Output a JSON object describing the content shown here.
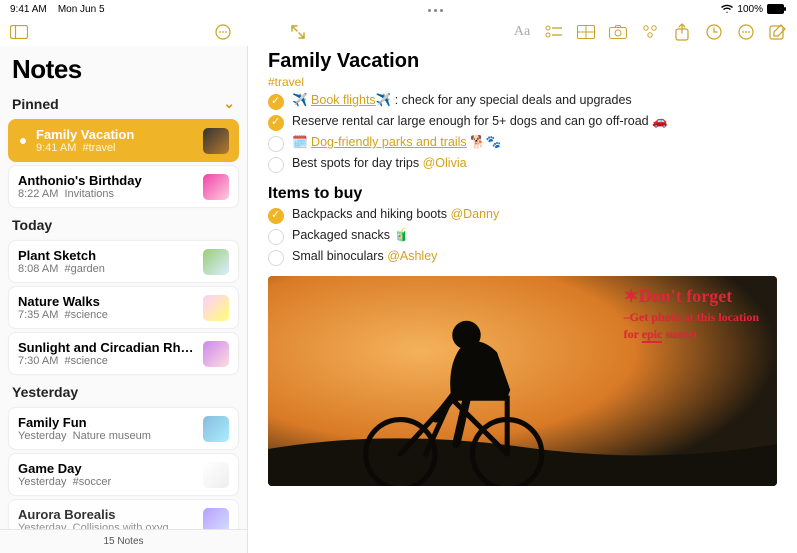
{
  "statusbar": {
    "time": "9:41 AM",
    "date": "Mon Jun 5",
    "battery": "100%"
  },
  "sidebar": {
    "title": "Notes",
    "sections": {
      "pinned": {
        "label": "Pinned",
        "items": [
          {
            "title": "Family Vacation",
            "time": "9:41 AM",
            "tag": "#travel"
          },
          {
            "title": "Anthonio's Birthday",
            "time": "8:22 AM",
            "tag": "Invitations"
          }
        ]
      },
      "today": {
        "label": "Today",
        "items": [
          {
            "title": "Plant Sketch",
            "time": "8:08 AM",
            "tag": "#garden"
          },
          {
            "title": "Nature Walks",
            "time": "7:35 AM",
            "tag": "#science"
          },
          {
            "title": "Sunlight and Circadian Rhy...",
            "time": "7:30 AM",
            "tag": "#science"
          }
        ]
      },
      "yesterday": {
        "label": "Yesterday",
        "items": [
          {
            "title": "Family Fun",
            "time": "Yesterday",
            "tag": "Nature museum"
          },
          {
            "title": "Game Day",
            "time": "Yesterday",
            "tag": "#soccer"
          },
          {
            "title": "Aurora Borealis",
            "time": "Yesterday",
            "tag": "Collisions with oxyg..."
          }
        ]
      }
    },
    "footer": "15 Notes"
  },
  "note": {
    "title": "Family Vacation",
    "tag": "#travel",
    "checklist1": [
      {
        "done": true,
        "pre": "✈️ ",
        "link": "Book flights",
        "post": "✈️ : check for any special deals and upgrades"
      },
      {
        "done": true,
        "text": "Reserve rental car large enough for 5+ dogs and can go off-road 🚗"
      },
      {
        "done": false,
        "pre": "🗓️ ",
        "link": "Dog-friendly parks and trails",
        "post": " 🐕🐾"
      },
      {
        "done": false,
        "text": "Best spots for day trips ",
        "mention": "@Olivia"
      }
    ],
    "section2": "Items to buy",
    "checklist2": [
      {
        "done": true,
        "text": "Backpacks and hiking boots ",
        "mention": "@Danny"
      },
      {
        "done": false,
        "text": "Packaged snacks 🧃"
      },
      {
        "done": false,
        "text": "Small binoculars ",
        "mention": "@Ashley"
      }
    ],
    "handwriting": {
      "line1": "✶Don't forget",
      "line2": "–Get photo at this location",
      "line3": "for ",
      "emph": "epic",
      "line3b": " sunset"
    }
  }
}
